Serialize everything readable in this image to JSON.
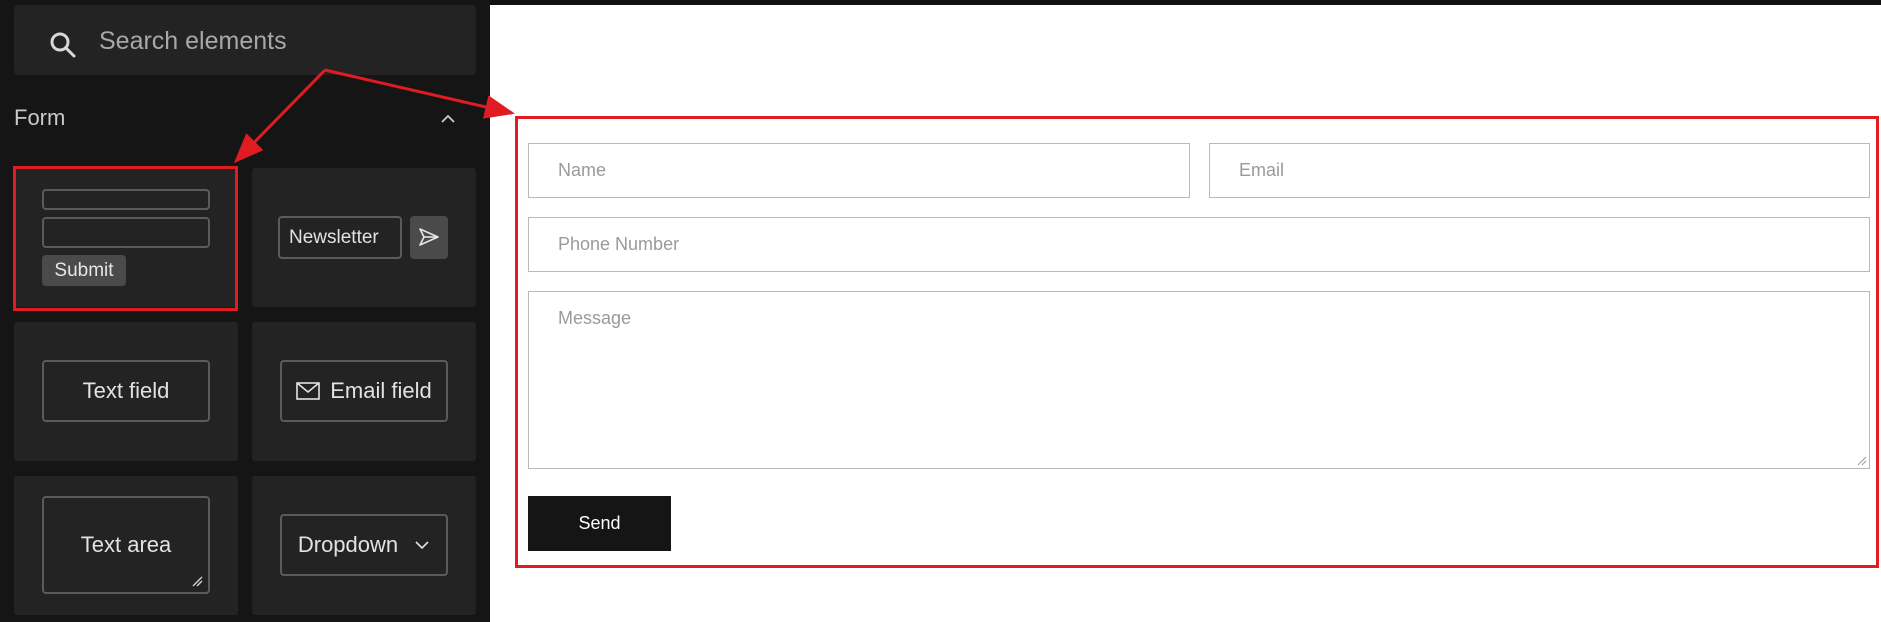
{
  "sidebar": {
    "search": {
      "placeholder": "Search elements",
      "icon": "search-icon"
    },
    "section": {
      "title": "Form",
      "icon": "chevron-up-icon"
    },
    "tiles": {
      "form": {
        "submit_label": "Submit"
      },
      "newsletter": {
        "input_label": "Newsletter",
        "icon": "send-icon"
      },
      "text_field": {
        "label": "Text field"
      },
      "email_field": {
        "label": "Email field",
        "icon": "envelope-icon"
      },
      "text_area": {
        "label": "Text area",
        "icon": "resize-handle-icon"
      },
      "dropdown": {
        "label": "Dropdown",
        "icon": "chevron-down-icon"
      }
    }
  },
  "form": {
    "name_placeholder": "Name",
    "email_placeholder": "Email",
    "phone_placeholder": "Phone Number",
    "message_placeholder": "Message",
    "send_label": "Send"
  },
  "colors": {
    "sidebar_bg": "#151515",
    "tile_bg": "#232323",
    "highlight": "#e11b22",
    "send_button": "#151515"
  }
}
